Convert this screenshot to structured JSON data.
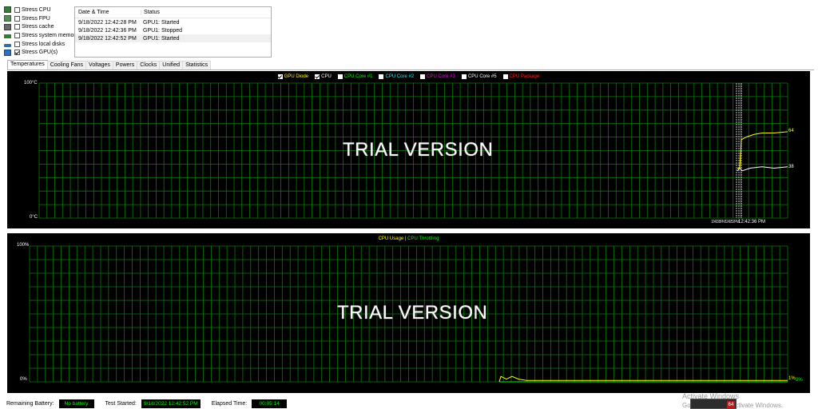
{
  "stress": [
    {
      "label": "Stress CPU",
      "checked": false,
      "icon": "cpu-chip-icon"
    },
    {
      "label": "Stress FPU",
      "checked": false,
      "icon": "fpu-chip-icon"
    },
    {
      "label": "Stress cache",
      "checked": false,
      "icon": "cache-chip-icon"
    },
    {
      "label": "Stress system memory",
      "checked": false,
      "icon": "memory-icon"
    },
    {
      "label": "Stress local disks",
      "checked": false,
      "icon": "disk-icon"
    },
    {
      "label": "Stress GPU(s)",
      "checked": true,
      "icon": "gpu-icon"
    }
  ],
  "log": {
    "headers": {
      "date": "Date & Time",
      "status": "Status"
    },
    "rows": [
      {
        "date": "9/18/2022 12:42:28 PM",
        "status": "GPU1: Started"
      },
      {
        "date": "9/18/2022 12:42:36 PM",
        "status": "GPU1: Stopped"
      },
      {
        "date": "9/18/2022 12:42:52 PM",
        "status": "GPU1: Started"
      }
    ]
  },
  "tabs": [
    "Temperatures",
    "Cooling Fans",
    "Voltages",
    "Powers",
    "Clocks",
    "Unified",
    "Statistics"
  ],
  "active_tab": "Temperatures",
  "temp_chart": {
    "legend": [
      {
        "label": "GPU Diode",
        "checked": true,
        "color": "#ffff00"
      },
      {
        "label": "CPU",
        "checked": true,
        "color": "#ffffff"
      },
      {
        "label": "CPU Core #1",
        "checked": false,
        "color": "#00ff00"
      },
      {
        "label": "CPU Core #2",
        "checked": false,
        "color": "#00ffff"
      },
      {
        "label": "CPU Core #3",
        "checked": false,
        "color": "#ff00ff"
      },
      {
        "label": "CPU Core #5",
        "checked": false,
        "color": "#ffffff"
      },
      {
        "label": "CPU Package",
        "checked": false,
        "color": "#ff0000"
      }
    ],
    "y_top": "100°C",
    "y_bottom": "0°C",
    "watermark": "TRIAL VERSION",
    "value_gpu": "64",
    "value_cpu": "38",
    "time_label": "12:42:36 PM",
    "time_overlap": "12:42:28 PM12:42:52 PM"
  },
  "usage_chart": {
    "legend_usage": "CPU Usage",
    "legend_sep": "|",
    "legend_throttle": "CPU Throttling",
    "y_top": "100%",
    "y_bottom": "0%",
    "watermark": "TRIAL VERSION",
    "value_usage": "1%",
    "value_throttle": "0%"
  },
  "status": {
    "battery_label": "Remaining Battery:",
    "battery_value": "No battery",
    "started_label": "Test Started:",
    "started_value": "9/18/2022 12:42:52 PM",
    "elapsed_label": "Elapsed Time:",
    "elapsed_value": "00:05:14"
  },
  "windows_watermark": {
    "line1": "Activate Windows",
    "line2": "Go to Settings to activate Windows."
  },
  "tray": {
    "badge": "64"
  },
  "chart_data": [
    {
      "type": "line",
      "y_unit": "°C",
      "ylim": [
        0,
        100
      ],
      "grid": true,
      "x": [
        "12:42:28 PM",
        "12:42:36 PM",
        "12:42:52 PM"
      ],
      "series": [
        {
          "name": "GPU Diode",
          "color": "#ffff00",
          "values": [
            37,
            58,
            64
          ]
        },
        {
          "name": "CPU",
          "color": "#ffffff",
          "values": [
            35,
            37,
            38
          ]
        }
      ]
    },
    {
      "type": "line",
      "y_unit": "%",
      "ylim": [
        0,
        100
      ],
      "grid": true,
      "series": [
        {
          "name": "CPU Usage",
          "color": "#ffff00",
          "values": [
            4,
            2,
            1,
            1,
            1,
            1
          ]
        },
        {
          "name": "CPU Throttling",
          "color": "#00ff00",
          "values": [
            0,
            0,
            0,
            0,
            0,
            0
          ]
        }
      ]
    }
  ]
}
